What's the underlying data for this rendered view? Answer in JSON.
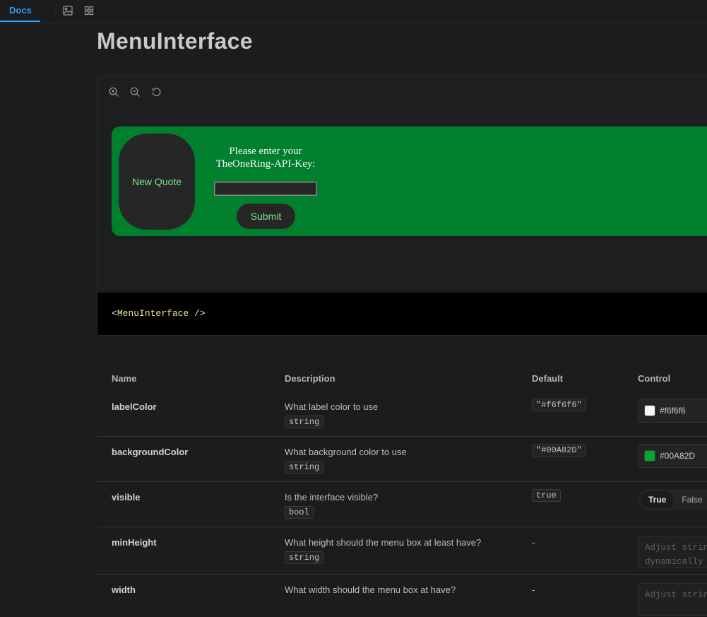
{
  "tabs": {
    "docs": "Docs"
  },
  "toolbar_icons": [
    "image-icon",
    "grid-icon"
  ],
  "page_title": "MenuInterface",
  "preview": {
    "zoom_icons": [
      "zoom-in-icon",
      "zoom-out-icon",
      "reset-zoom-icon"
    ],
    "menu_background": "#00802d",
    "quote_button": "New Quote",
    "prompt_line1": "Please enter your",
    "prompt_line2": "TheOneRing-API-Key:",
    "api_key_value": "",
    "submit_button": "Submit",
    "code": {
      "open": "<",
      "tag": "MenuInterface",
      "close": " />"
    }
  },
  "table": {
    "headers": {
      "name": "Name",
      "description": "Description",
      "default": "Default",
      "control": "Control"
    },
    "rows": [
      {
        "name": "labelColor",
        "description": "What label color to use",
        "type": "string",
        "default": "\"#f6f6f6\"",
        "control_value": "#f6f6f6",
        "swatch": "#f6f6f6"
      },
      {
        "name": "backgroundColor",
        "description": "What background color to use",
        "type": "string",
        "default": "\"#00A82D\"",
        "control_value": "#00A82D",
        "swatch": "#00a82d"
      },
      {
        "name": "visible",
        "description": "Is the interface visible?",
        "type": "bool",
        "default": "true",
        "toggle_true": "True",
        "toggle_false": "False",
        "toggle_selected": "True"
      },
      {
        "name": "minHeight",
        "description": "What height should the menu box at least have?",
        "type": "string",
        "default": "-",
        "placeholder": "Adjust string\ndynamically"
      },
      {
        "name": "width",
        "description": "What width should the menu box at have?",
        "default": "-",
        "placeholder": "Adjust string"
      }
    ]
  }
}
